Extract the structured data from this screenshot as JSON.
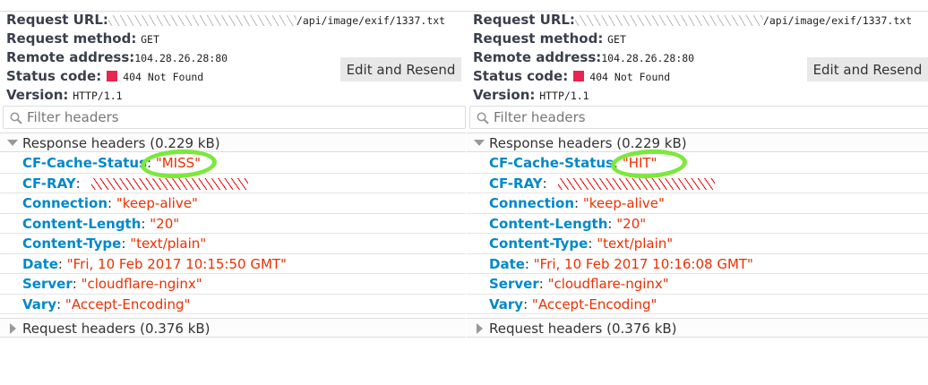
{
  "labels": {
    "request_url": "Request URL:",
    "request_method": "Request method:",
    "remote_address": "Remote address:",
    "status_code": "Status code:",
    "version": "Version:",
    "edit_resend": "Edit and Resend",
    "filter_placeholder": "Filter headers"
  },
  "status_color": "#e9244e",
  "panels": [
    {
      "url_suffix": "/api/image/exif/1337.txt",
      "method": "GET",
      "remote": "104.28.26.28:80",
      "status": "404 Not Found",
      "version": "HTTP/1.1",
      "response_section": "Response headers (0.229 kB)",
      "request_section": "Request headers (0.376 kB)",
      "headers": [
        {
          "k": "CF-Cache-Status",
          "v": "\"MISS\""
        },
        {
          "k": "CF-RAY",
          "v": ""
        },
        {
          "k": "Connection",
          "v": "\"keep-alive\""
        },
        {
          "k": "Content-Length",
          "v": "\"20\""
        },
        {
          "k": "Content-Type",
          "v": "\"text/plain\""
        },
        {
          "k": "Date",
          "v": "\"Fri, 10 Feb 2017 10:15:50 GMT\""
        },
        {
          "k": "Server",
          "v": "\"cloudflare-nginx\""
        },
        {
          "k": "Vary",
          "v": "\"Accept-Encoding\""
        }
      ]
    },
    {
      "url_suffix": "/api/image/exif/1337.txt",
      "method": "GET",
      "remote": "104.28.26.28:80",
      "status": "404 Not Found",
      "version": "HTTP/1.1",
      "response_section": "Response headers (0.229 kB)",
      "request_section": "Request headers (0.376 kB)",
      "headers": [
        {
          "k": "CF-Cache-Status",
          "v": "\"HIT\""
        },
        {
          "k": "CF-RAY",
          "v": ""
        },
        {
          "k": "Connection",
          "v": "\"keep-alive\""
        },
        {
          "k": "Content-Length",
          "v": "\"20\""
        },
        {
          "k": "Content-Type",
          "v": "\"text/plain\""
        },
        {
          "k": "Date",
          "v": "\"Fri, 10 Feb 2017 10:16:08 GMT\""
        },
        {
          "k": "Server",
          "v": "\"cloudflare-nginx\""
        },
        {
          "k": "Vary",
          "v": "\"Accept-Encoding\""
        }
      ]
    }
  ]
}
